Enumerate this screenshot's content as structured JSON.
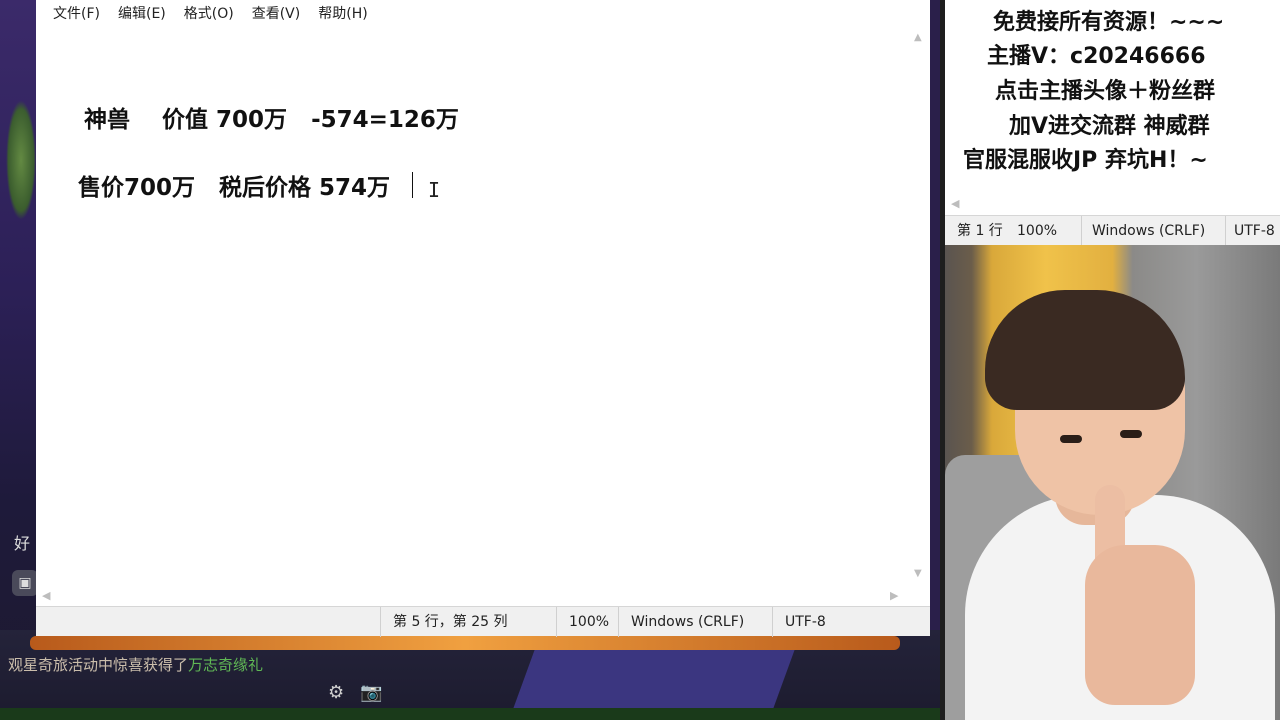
{
  "menu": [
    "文件(F)",
    "编辑(E)",
    "格式(O)",
    "查看(V)",
    "帮助(H)"
  ],
  "editor": {
    "line1": "神兽    价值 700万   -574=126万",
    "line2": "售价700万   税后价格 574万"
  },
  "status": {
    "position": "第 5 行，第 25 列",
    "zoom": "100%",
    "eol": "Windows (CRLF)",
    "encoding": "UTF-8"
  },
  "right_panel": {
    "lines": [
      "免费接所有资源！~~~",
      "主播V：c20246666",
      "点击主播头像＋粉丝群",
      "加V进交流群 神威群",
      "官服混服收JP    弃坑H！~"
    ],
    "status": {
      "line": "第 1 行",
      "zoom": "100%",
      "eol": "Windows (CRLF)",
      "encoding": "UTF-8"
    }
  },
  "game": {
    "marquee_prefix": "观星奇旅活动中惊喜获得了",
    "marquee_highlight": "万志奇缘礼",
    "side_text": "好"
  }
}
